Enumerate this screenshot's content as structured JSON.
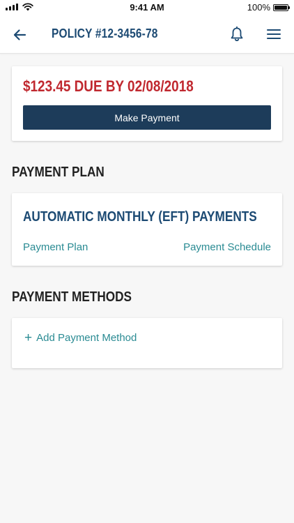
{
  "status_bar": {
    "time": "9:41 AM",
    "battery": "100%",
    "signal_icon": "signal-bars-icon",
    "wifi_icon": "wifi-icon",
    "battery_icon": "battery-icon"
  },
  "header": {
    "title": "POLICY #12-3456-78",
    "back_icon": "arrow-left-icon",
    "notification_icon": "bell-icon",
    "menu_icon": "hamburger-menu-icon"
  },
  "due": {
    "text": "$123.45 DUE BY 02/08/2018",
    "button_label": "Make Payment"
  },
  "payment_plan": {
    "section_title": "PAYMENT PLAN",
    "plan_name": "AUTOMATIC MONTHLY (EFT) PAYMENTS",
    "plan_link": "Payment Plan",
    "schedule_link": "Payment Schedule"
  },
  "payment_methods": {
    "section_title": "PAYMENT METHODS",
    "add_label": "Add Payment Method",
    "add_icon": "plus-icon"
  },
  "colors": {
    "brand_navy": "#1c4a73",
    "button_navy": "#1d3c5a",
    "due_red": "#c0282f",
    "link_teal": "#2a8b93",
    "background": "#f7f7f7"
  }
}
